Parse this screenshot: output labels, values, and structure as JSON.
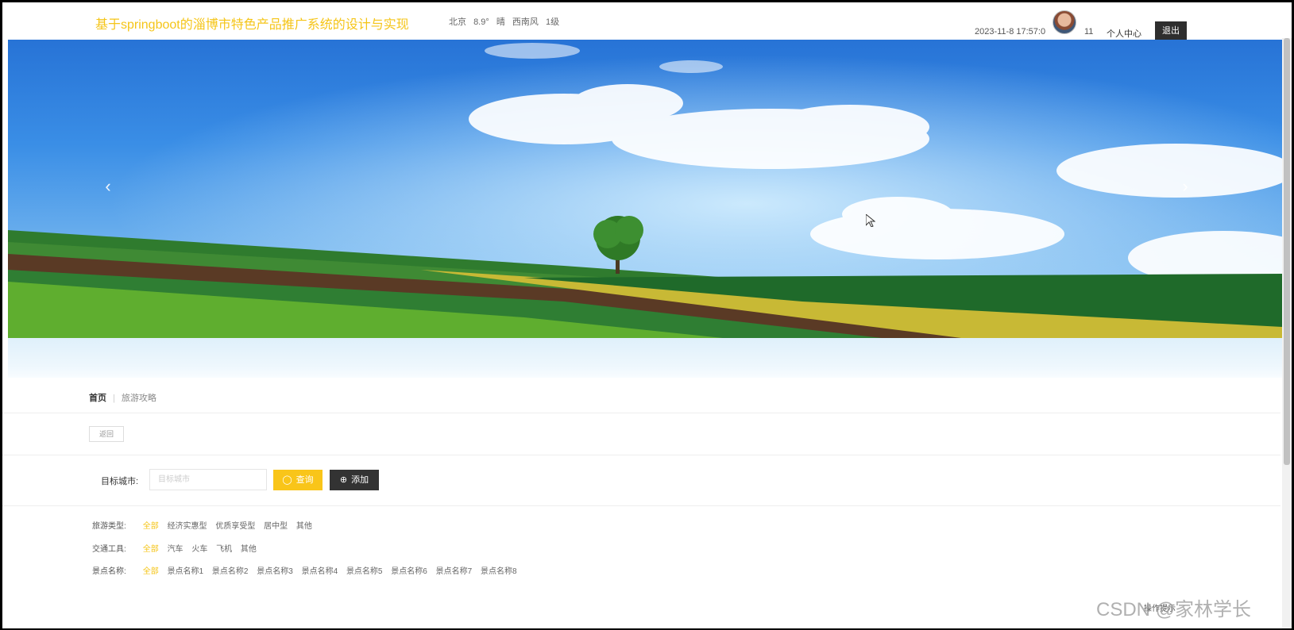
{
  "header": {
    "site_title": "基于springboot的淄博市特色产品推广系统的设计与实现",
    "weather": {
      "city": "北京",
      "temperature": "8.9°",
      "condition": "晴",
      "wind": "西南风",
      "wind_level": "1级"
    },
    "datetime": "2023-11-8 17:57:0",
    "user_count": "11",
    "user_center_label": "个人中心",
    "logout_label": "退出"
  },
  "banner": {
    "prev_arrow": "‹",
    "next_arrow": "›"
  },
  "breadcrumb": {
    "home": "首页",
    "current": "旅游攻略"
  },
  "back_label": "返回",
  "search": {
    "label": "目标城市:",
    "placeholder": "目标城市",
    "query_label": "查询",
    "add_label": "添加"
  },
  "filters": {
    "travel_type": {
      "label": "旅游类型:",
      "options": [
        "全部",
        "经济实惠型",
        "优质享受型",
        "居中型",
        "其他"
      ]
    },
    "transport": {
      "label": "交通工具:",
      "options": [
        "全部",
        "汽车",
        "火车",
        "飞机",
        "其他"
      ]
    },
    "spot_name": {
      "label": "景点名称:",
      "options": [
        "全部",
        "景点名称1",
        "景点名称2",
        "景点名称3",
        "景点名称4",
        "景点名称5",
        "景点名称6",
        "景点名称7",
        "景点名称8"
      ]
    }
  },
  "footer_text": "操作提示",
  "watermark": "CSDN @家林学长",
  "colors": {
    "accent": "#f9c519",
    "dark_button": "#333333"
  },
  "icons": {
    "query": "search-icon",
    "add": "plus-circle-icon"
  }
}
